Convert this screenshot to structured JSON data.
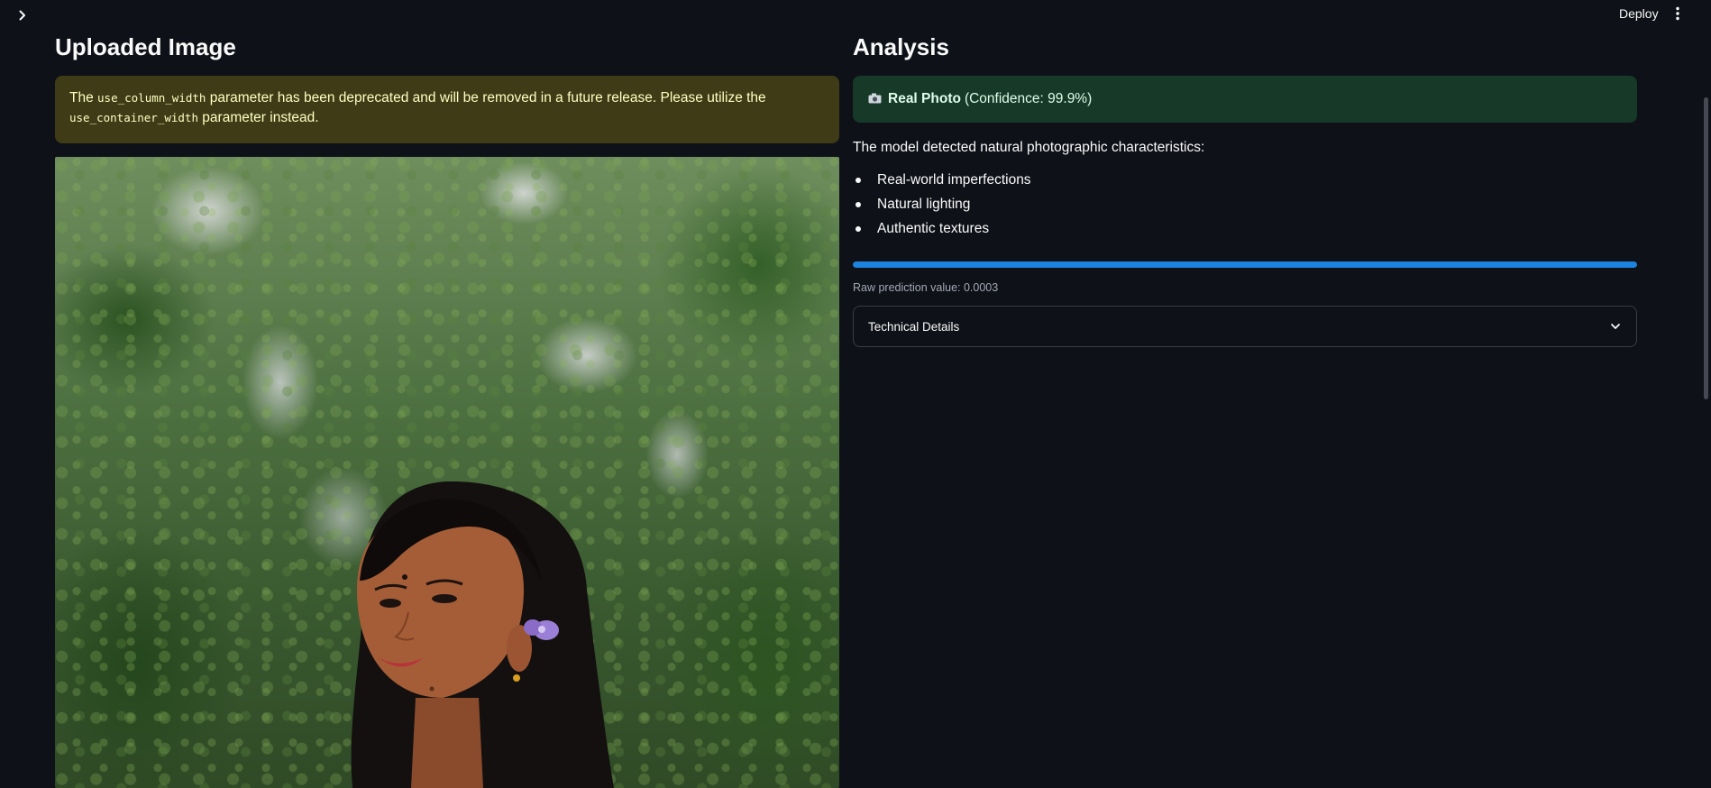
{
  "header": {
    "deploy_label": "Deploy",
    "icons": {
      "sidebar_toggle": "chevron-right-icon",
      "menu": "kebab-menu-icon"
    }
  },
  "left": {
    "title": "Uploaded Image",
    "warning": {
      "pre": "The ",
      "code1": "use_column_width",
      "mid": " parameter has been deprecated and will be removed in a future release. Please utilize the ",
      "code2": "use_container_width",
      "post": " parameter instead."
    }
  },
  "right": {
    "title": "Analysis",
    "result": {
      "icon": "camera-icon",
      "label": "Real Photo",
      "confidence": "(Confidence: 99.9%)"
    },
    "description": "The model detected natural photographic characteristics:",
    "features": [
      "Real-world imperfections",
      "Natural lighting",
      "Authentic textures"
    ],
    "progress": 0.9997,
    "raw_prediction": "Raw prediction value: 0.0003",
    "expander_label": "Technical Details"
  },
  "colors": {
    "background": "#0e1117",
    "warning_bg": "#3e3b16",
    "warning_text": "#ffffc2",
    "success_bg": "#173928",
    "success_text": "#dffde9",
    "progress": "#1c83e1"
  }
}
